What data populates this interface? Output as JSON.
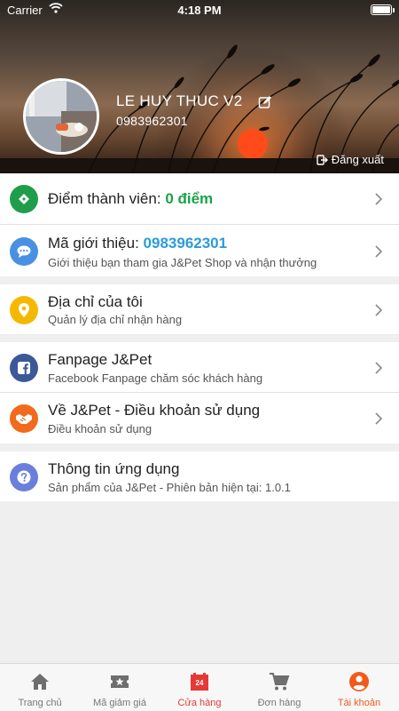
{
  "status_bar": {
    "carrier": "Carrier",
    "time": "4:18 PM"
  },
  "profile": {
    "name": "LE HUY THUC V2",
    "phone": "0983962301",
    "logout_label": "Đăng xuất"
  },
  "menu": {
    "points": {
      "label": "Điểm thành viên:",
      "value": "0 điểm",
      "color": "#1aa34a"
    },
    "referral": {
      "label": "Mã giới thiệu:",
      "value": "0983962301",
      "subtitle": "Giới thiệu bạn tham gia J&Pet Shop và nhận thưởng",
      "color": "#4a90e2"
    },
    "address": {
      "title": "Địa chỉ của tôi",
      "subtitle": "Quản lý địa chỉ nhận hàng",
      "color": "#f5b800"
    },
    "fanpage": {
      "title": "Fanpage J&Pet",
      "subtitle": "Facebook Fanpage chăm sóc khách hàng",
      "color": "#3b5998"
    },
    "about": {
      "title": "Về J&Pet - Điều khoản sử dụng",
      "subtitle": "Điều khoản sử dụng",
      "color": "#f26a1b"
    },
    "app_info": {
      "title": "Thông tin ứng dụng",
      "subtitle": "Sản phẩm của J&Pet - Phiên bản hiện tại: 1.0.1",
      "color": "#6a7fdb"
    }
  },
  "tabbar": {
    "tabs": [
      {
        "label": "Trang chủ",
        "icon": "home-icon"
      },
      {
        "label": "Mã giảm giá",
        "icon": "ticket-star-icon"
      },
      {
        "label": "Cửa hàng",
        "icon": "store-24-icon"
      },
      {
        "label": "Đơn hàng",
        "icon": "cart-icon"
      },
      {
        "label": "Tài khoản",
        "icon": "account-icon",
        "active": true
      }
    ],
    "active_color": "#f05a1a",
    "store_color": "#e53935"
  }
}
